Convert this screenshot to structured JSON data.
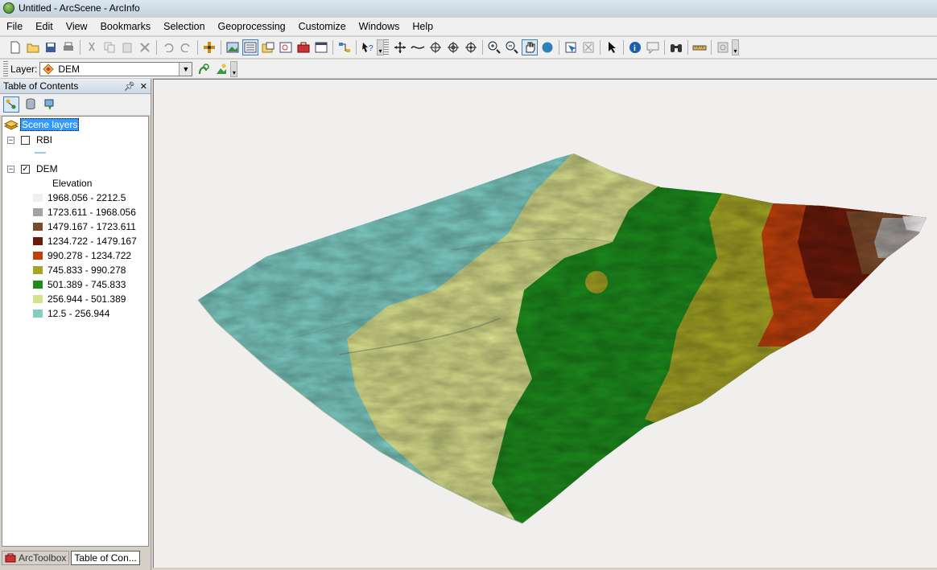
{
  "window": {
    "title": "Untitled - ArcScene - ArcInfo"
  },
  "menu": [
    "File",
    "Edit",
    "View",
    "Bookmarks",
    "Selection",
    "Geoprocessing",
    "Customize",
    "Windows",
    "Help"
  ],
  "layer_toolbar": {
    "label": "Layer:",
    "selected": "DEM"
  },
  "toc": {
    "title": "Table of Contents",
    "pin_icon": "pin-icon",
    "close_icon": "close-icon",
    "root": "Scene layers",
    "layers": [
      {
        "name": "RBI",
        "checked": false
      },
      {
        "name": "DEM",
        "checked": true,
        "field": "Elevation"
      }
    ],
    "legend": [
      {
        "label": "1968.056 - 2212.5",
        "color": "#f2eeef"
      },
      {
        "label": "1723.611 - 1968.056",
        "color": "#a8a29e"
      },
      {
        "label": "1479.167 - 1723.611",
        "color": "#7c4a2a"
      },
      {
        "label": "1234.722 - 1479.167",
        "color": "#6b1a0a"
      },
      {
        "label": "990.278 - 1234.722",
        "color": "#c0400c"
      },
      {
        "label": "745.833 - 990.278",
        "color": "#a5a526"
      },
      {
        "label": "501.389 - 745.833",
        "color": "#1d8c1d"
      },
      {
        "label": "256.944 - 501.389",
        "color": "#d9e08c"
      },
      {
        "label": "12.5 - 256.944",
        "color": "#7ecfc6"
      }
    ]
  },
  "tabs": [
    {
      "label": "ArcToolbox",
      "active": false
    },
    {
      "label": "Table of Con...",
      "active": true
    }
  ]
}
